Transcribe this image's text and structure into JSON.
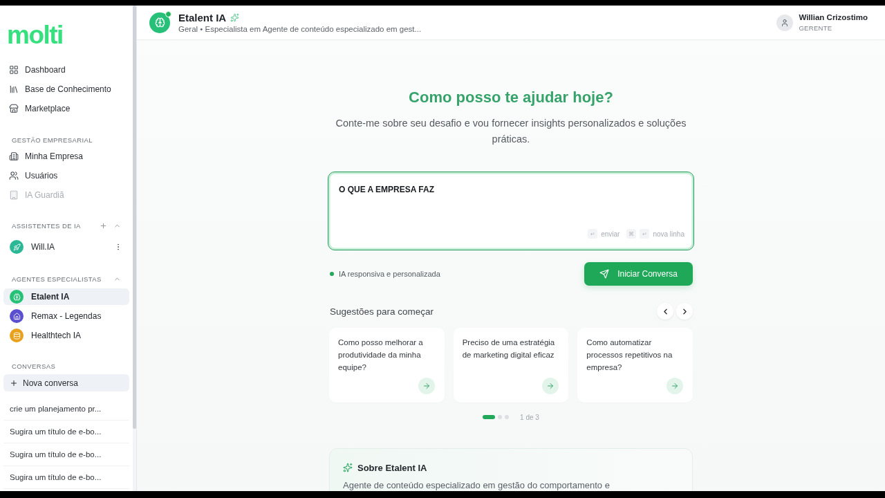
{
  "sidebar": {
    "logo": "molti",
    "main_nav": [
      {
        "label": "Dashboard",
        "selected": false
      },
      {
        "label": "Base de Conhecimento",
        "selected": false
      },
      {
        "label": "Marketplace",
        "selected": false
      }
    ],
    "business": {
      "title": "GESTÃO EMPRESARIAL",
      "items": [
        {
          "label": "Minha Empresa",
          "selected": false,
          "disabled": false
        },
        {
          "label": "Usuários",
          "selected": false,
          "disabled": false
        },
        {
          "label": "IA Guardiã",
          "selected": false,
          "disabled": true
        }
      ]
    },
    "assistants": {
      "title": "ASSISTENTES DE IA",
      "expanded": true,
      "items": [
        {
          "label": "Will.IA",
          "color": "#2cb896",
          "selected": false
        }
      ]
    },
    "agents": {
      "title": "AGENTES ESPECIALISTAS",
      "expanded": true,
      "items": [
        {
          "label": "Etalent IA",
          "color": "#25c177",
          "selected": true
        },
        {
          "label": "Remax - Legendas",
          "color": "#5a4fcf",
          "selected": false
        },
        {
          "label": "Healthtech IA",
          "color": "#e8a11c",
          "selected": false
        }
      ]
    },
    "conversations": {
      "title": "CONVERSAS",
      "new_button": "Nova conversa",
      "items": [
        {
          "title": "crie um planejamento pr...",
          "selected": false
        },
        {
          "title": "Sugira um título de e-bo...",
          "selected": false
        },
        {
          "title": "Sugira um título de e-bo...",
          "selected": false
        },
        {
          "title": "Sugira um título de e-bo...",
          "selected": false
        }
      ]
    }
  },
  "header": {
    "title": "Etalent IA",
    "subtitle": "Geral • Especialista em Agente de conteúdo especializado em gest...",
    "online": true,
    "user": {
      "name": "Willian Crizostimo",
      "role": "GERENTE"
    }
  },
  "hero": {
    "heading": "Como posso te ajudar hoje?",
    "intro": "Conte-me sobre seu desafio e vou fornecer insights personalizados e soluções práticas."
  },
  "composer": {
    "value": "O QUE A EMPRESA FAZ",
    "focused": true,
    "hints": [
      {
        "keys": [
          "↵"
        ],
        "label": "enviar"
      },
      {
        "keys": [
          "⌘",
          "↵"
        ],
        "label": "nova linha"
      }
    ]
  },
  "status": {
    "text": "IA responsiva e personalizada"
  },
  "start_button": "Iniciar Conversa",
  "suggestions": {
    "title": "Sugestões para começar",
    "cards": [
      "Como posso melhorar a produtividade da minha equipe?",
      "Preciso de uma estratégia de marketing digital eficaz",
      "Como automatizar processos repetitivos na empresa?"
    ],
    "pages": [
      {
        "selected": true
      },
      {
        "selected": false
      },
      {
        "selected": false
      }
    ],
    "page_label": "1 de 3"
  },
  "about": {
    "title": "Sobre Etalent IA",
    "text": "Agente de conteúdo especializado em gestão do comportamento e"
  }
}
